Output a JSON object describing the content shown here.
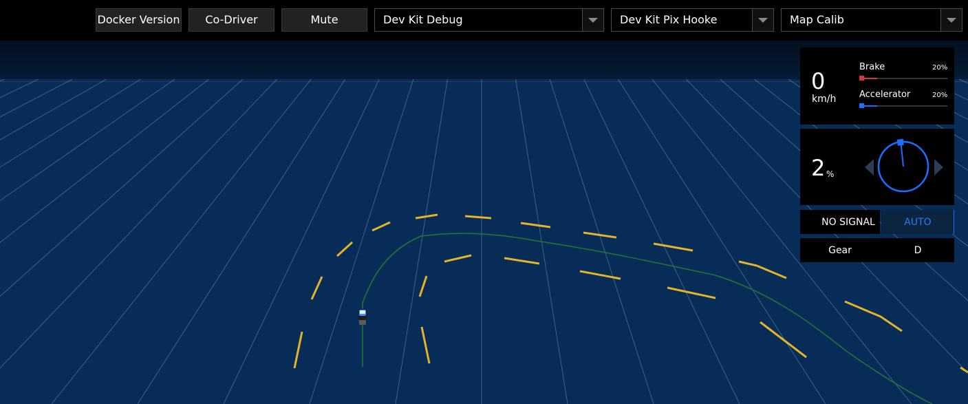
{
  "toolbar": {
    "docker_version_label": "Docker Version",
    "co_driver_label": "Co-Driver",
    "mute_label": "Mute",
    "mode_select": "Dev Kit Debug",
    "vehicle_select": "Dev Kit Pix Hooke",
    "map_select": "Map Calib"
  },
  "dashboard": {
    "speed": "0",
    "speed_unit": "km/h",
    "brake_label": "Brake",
    "brake_value": "20%",
    "brake_fraction": 0.2,
    "accelerator_label": "Accelerator",
    "accelerator_value": "20%",
    "accelerator_fraction": 0.2,
    "steering_value": "2",
    "steering_unit": "%",
    "signal_status": "NO SIGNAL",
    "driving_mode": "AUTO",
    "gear_label": "Gear",
    "gear_value": "D"
  },
  "colors": {
    "ground": "#062c57",
    "grid_line": "#6f8fb0",
    "lane_line": "#e5b22a",
    "route_line": "#1f7a32",
    "brake": "#d63a3a",
    "accelerator": "#1a6fff",
    "auto_active": "#1a6fff"
  },
  "icons": {
    "ego_vehicle": "car-icon",
    "steer_left": "triangle-left-icon",
    "steer_right": "triangle-right-icon",
    "dropdown": "chevron-down-icon"
  }
}
